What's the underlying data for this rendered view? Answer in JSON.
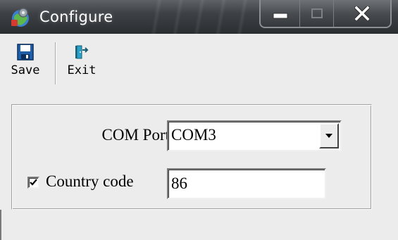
{
  "window": {
    "title": "Configure",
    "icon": "settings-globe-icon",
    "caption_buttons": [
      "minimize-icon",
      "maximize-icon",
      "close-icon"
    ]
  },
  "toolbar": {
    "save_label": "Save",
    "save_icon": "floppy-disk-icon",
    "exit_label": "Exit",
    "exit_icon": "exit-door-icon"
  },
  "form": {
    "com_port_label": "COM Port",
    "com_port_value": "COM3",
    "country_code_checked": true,
    "country_code_label": "Country code",
    "country_code_value": "86"
  },
  "colors": {
    "titlebar": "#2b2e31",
    "window_bg": "#ececec",
    "save_icon": "#1f5fa8",
    "exit_icon": "#2aa1c9"
  }
}
